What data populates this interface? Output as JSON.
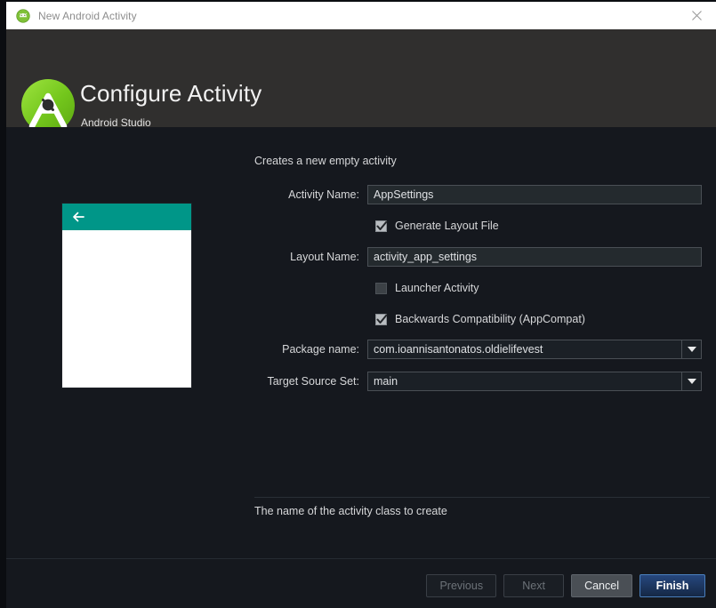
{
  "window": {
    "title": "New Android Activity",
    "app_icon": "android-icon",
    "close_icon": "close-icon"
  },
  "header": {
    "logo_icon": "android-studio-logo",
    "title": "Configure Activity",
    "subtitle": "Android Studio"
  },
  "preview": {
    "back_icon": "arrow-left-icon",
    "appbar_color": "#009688",
    "canvas_color": "#ffffff"
  },
  "form": {
    "description": "Creates a new empty activity",
    "activity_name": {
      "label": "Activity Name:",
      "value": "AppSettings"
    },
    "generate_layout_file": {
      "label": "Generate Layout File",
      "checked": true
    },
    "layout_name": {
      "label": "Layout Name:",
      "value": "activity_app_settings"
    },
    "launcher_activity": {
      "label": "Launcher Activity",
      "checked": false
    },
    "backwards_compatibility": {
      "label": "Backwards Compatibility (AppCompat)",
      "checked": true
    },
    "package_name": {
      "label": "Package name:",
      "value": "com.ioannisantonatos.oldielifevest"
    },
    "target_source_set": {
      "label": "Target Source Set:",
      "value": "main"
    },
    "hint": "The name of the activity class to create"
  },
  "footer": {
    "previous": "Previous",
    "next": "Next",
    "cancel": "Cancel",
    "finish": "Finish"
  }
}
